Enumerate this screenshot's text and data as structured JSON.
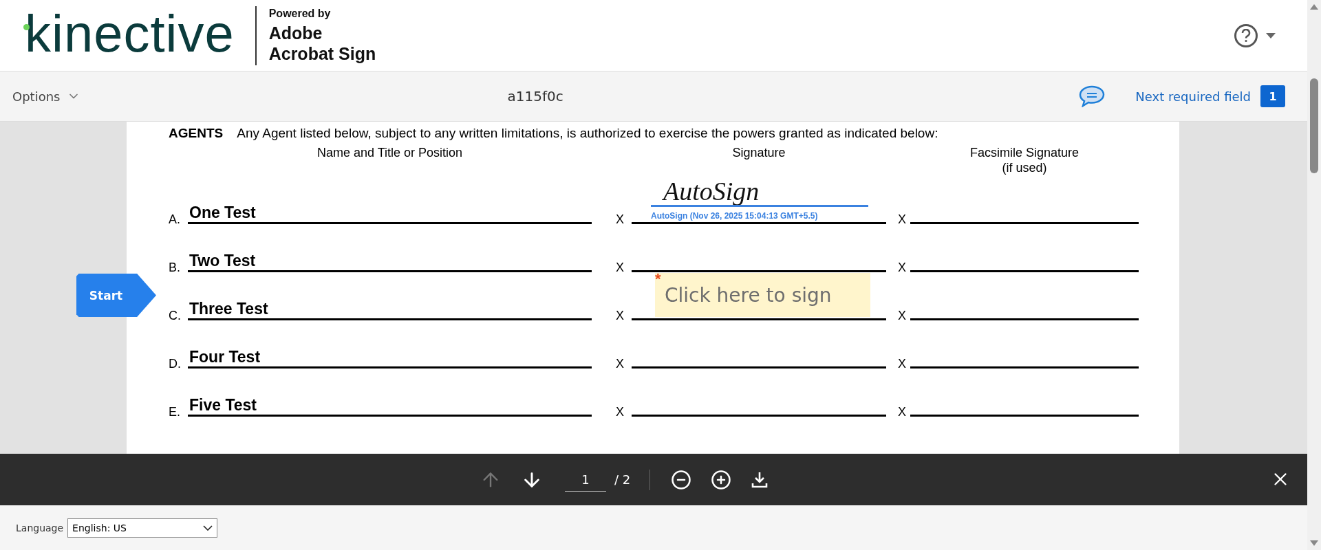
{
  "header": {
    "brand": "kinective",
    "powered_by": [
      "Powered by",
      "Adobe",
      "Acrobat Sign"
    ]
  },
  "toolbar": {
    "options": "Options",
    "document_id": "a115f0c",
    "next_required": "Next required field",
    "required_count": "1"
  },
  "document": {
    "intro": "**AGENTS**    Any Agent listed below, subject to any written limitations, is authorized to exercise the powers granted as indicated below:",
    "columns": [
      {
        "label": "Name and Title or Position"
      },
      {
        "label": "Signature"
      },
      {
        "label": "Facsimile Signature",
        "note": "(if used)"
      }
    ],
    "rows": [
      {
        "letter": "A.",
        "name": "One Test",
        "mark": "X",
        "facsimile_mark": "X",
        "signature": {
          "kind": "signed",
          "script": "AutoSign",
          "caption": "AutoSign (Nov 26, 2025 15:04:13 GMT+5.5)"
        }
      },
      {
        "letter": "B.",
        "name": "Two Test",
        "mark": "X",
        "facsimile_mark": "X",
        "signature": {
          "kind": "empty"
        }
      },
      {
        "letter": "C.",
        "name": "Three Test",
        "mark": "X",
        "facsimile_mark": "X",
        "start_label": "Start",
        "signature": {
          "kind": "required",
          "required_mark": "*",
          "placeholder": "Click here to sign"
        }
      },
      {
        "letter": "D.",
        "name": "Four Test",
        "mark": "X",
        "facsimile_mark": "X",
        "signature": {
          "kind": "empty"
        }
      },
      {
        "letter": "E.",
        "name": "Five Test",
        "mark": "X",
        "facsimile_mark": "X",
        "signature": {
          "kind": "empty"
        }
      }
    ]
  },
  "pager": {
    "previous_disabled": true,
    "page": "1",
    "total": "/ 2"
  },
  "footer": {
    "language_label": "Language",
    "language": "English: US"
  }
}
